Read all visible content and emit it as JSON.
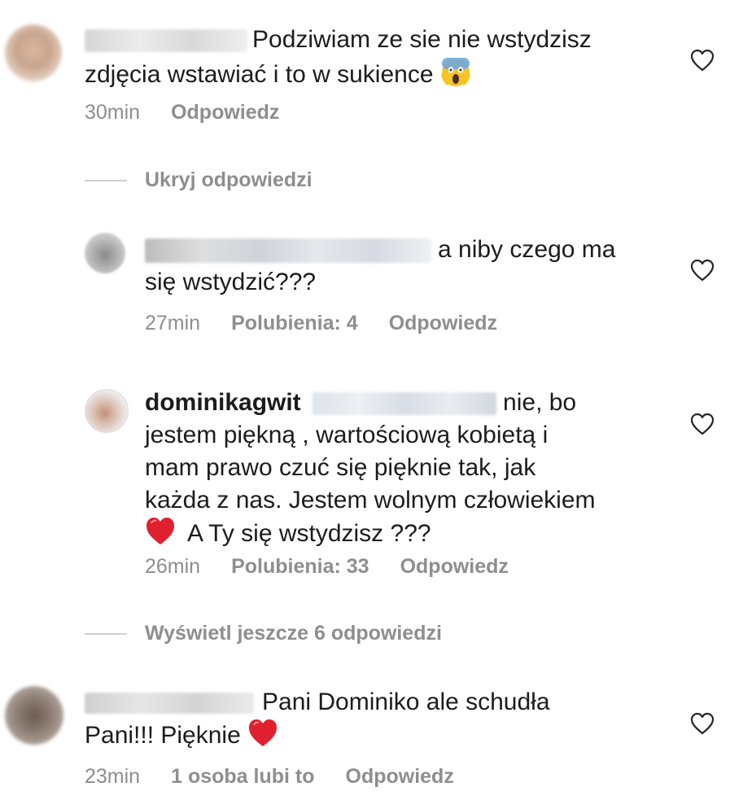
{
  "comments": [
    {
      "text_line1": "Podziwiam ze sie nie wstydzisz",
      "text_line2": "zdjęcia wstawiać i to w sukience",
      "time": "30min",
      "reply": "Odpowiedz"
    },
    {
      "text_line1": "a niby czego ma",
      "text_line2": "się wstydzić???",
      "time": "27min",
      "likes": "Polubienia: 4",
      "reply": "Odpowiedz"
    },
    {
      "username": "dominikagwit",
      "text_line1": "nie,  bo",
      "text_line2": "jestem piękną , wartościową kobietą i",
      "text_line3": "mam prawo czuć się pięknie tak, jak",
      "text_line4": "każda z nas. Jestem wolnym człowiekiem",
      "text_line5": "A Ty się wstydzisz ???",
      "time": "26min",
      "likes": "Polubienia: 33",
      "reply": "Odpowiedz"
    },
    {
      "text_line1": "Pani Dominiko ale schudła",
      "text_line2": "Pani!!! Pięknie",
      "time": "23min",
      "likes": "1 osoba lubi to",
      "reply": "Odpowiedz"
    }
  ],
  "hide_replies": "Ukryj odpowiedzi",
  "show_more_replies": "Wyświetl jeszcze 6 odpowiedzi",
  "colors": {
    "meta": "#8e8e8e",
    "text": "#1c1c1c",
    "heart_red": "#e0202e"
  },
  "icons": {
    "like": "heart-outline-icon",
    "scream_emoji": "screaming-face-emoji",
    "heart_emoji": "red-heart-emoji"
  }
}
